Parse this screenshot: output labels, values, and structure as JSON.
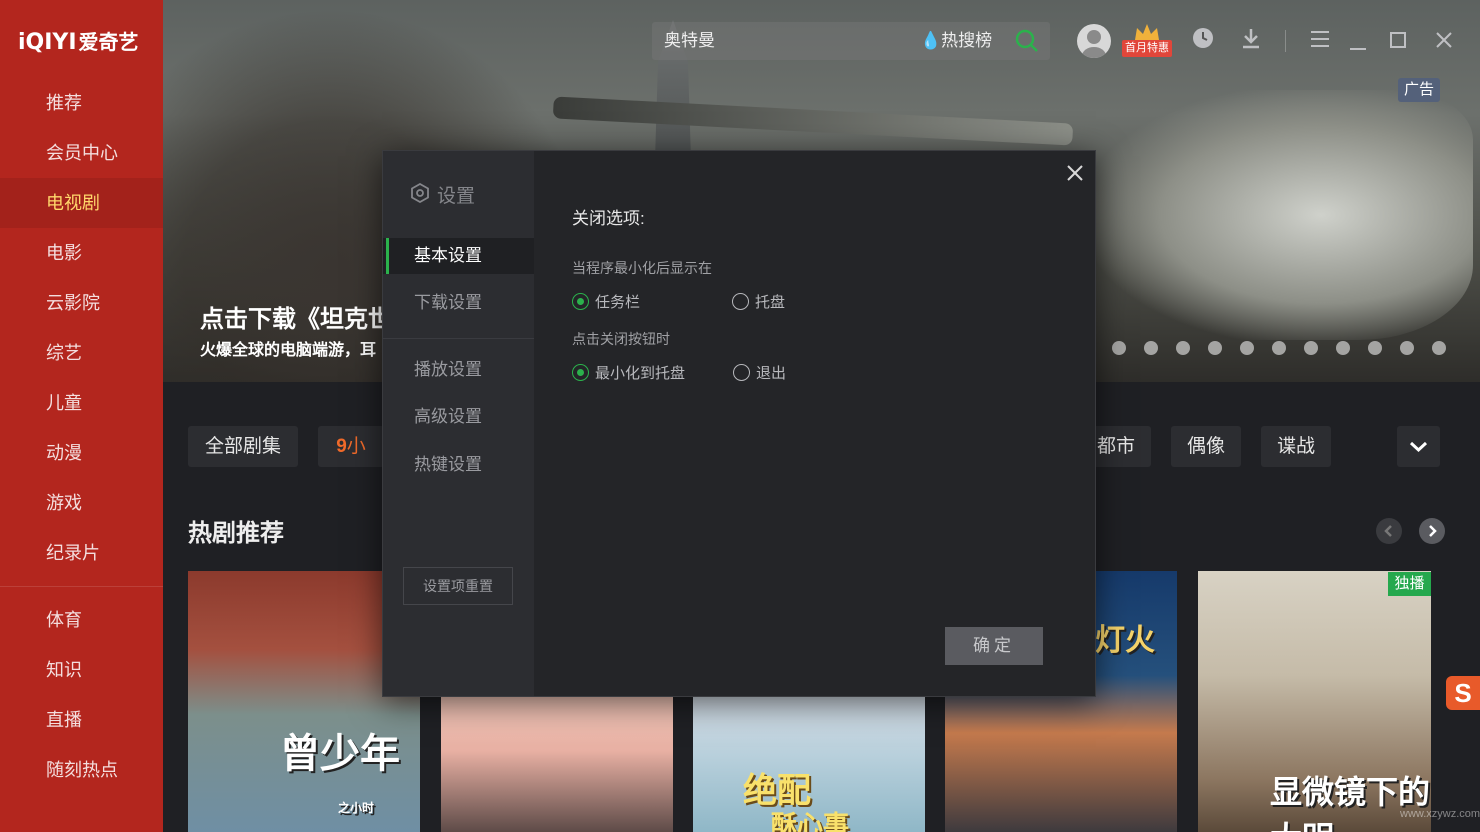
{
  "app": {
    "logo_latin": "iQIYI",
    "logo_cn": "爱奇艺"
  },
  "sidebar": {
    "items": [
      {
        "label": "推荐"
      },
      {
        "label": "会员中心"
      },
      {
        "label": "电视剧",
        "active": true
      },
      {
        "label": "电影"
      },
      {
        "label": "云影院"
      },
      {
        "label": "综艺"
      },
      {
        "label": "儿童"
      },
      {
        "label": "动漫"
      },
      {
        "label": "游戏"
      },
      {
        "label": "纪录片"
      }
    ],
    "items2": [
      {
        "label": "体育"
      },
      {
        "label": "知识"
      },
      {
        "label": "直播"
      },
      {
        "label": "随刻热点"
      }
    ],
    "accent_color": "#b3261e",
    "active_text_color": "#ffd76b"
  },
  "topbar": {
    "search_value": "奥特曼",
    "hot_label": "热搜榜",
    "vip_badge": "首月特惠",
    "icons": [
      "search-icon",
      "avatar",
      "history-icon",
      "download-icon",
      "menu-icon",
      "minimize-icon",
      "maximize-icon",
      "close-icon"
    ]
  },
  "hero": {
    "title": "点击下载《坦克世",
    "subtitle": "火爆全球的电脑端游，耳",
    "ad_label": "广告",
    "dot_count": 11
  },
  "categories": {
    "chips": [
      "全部剧集",
      "都市",
      "偶像",
      "谍战"
    ],
    "partial_chip_text": "小"
  },
  "section": {
    "title": "热剧推荐"
  },
  "posters": [
    {
      "title": "曾少年",
      "sub": "之小时"
    },
    {
      "title": ""
    },
    {
      "title": "绝配",
      "sub": "酥心事"
    },
    {
      "title": "灯火"
    },
    {
      "title": "显微镜下的大明",
      "badge": "独播"
    }
  ],
  "watermark": "www.xzywz.com",
  "settings": {
    "title": "设置",
    "menu": [
      {
        "label": "基本设置",
        "active": true
      },
      {
        "label": "下载设置"
      },
      {
        "label": "播放设置"
      },
      {
        "label": "高级设置"
      },
      {
        "label": "热键设置"
      }
    ],
    "reset_label": "设置项重置",
    "section_title": "关闭选项:",
    "q1": "当程序最小化后显示在",
    "q1_options": [
      {
        "label": "任务栏",
        "checked": true
      },
      {
        "label": "托盘",
        "checked": false
      }
    ],
    "q2": "点击关闭按钮时",
    "q2_options": [
      {
        "label": "最小化到托盘",
        "checked": true
      },
      {
        "label": "退出",
        "checked": false
      }
    ],
    "ok_label": "确定",
    "radio_color": "#2bb24c"
  }
}
